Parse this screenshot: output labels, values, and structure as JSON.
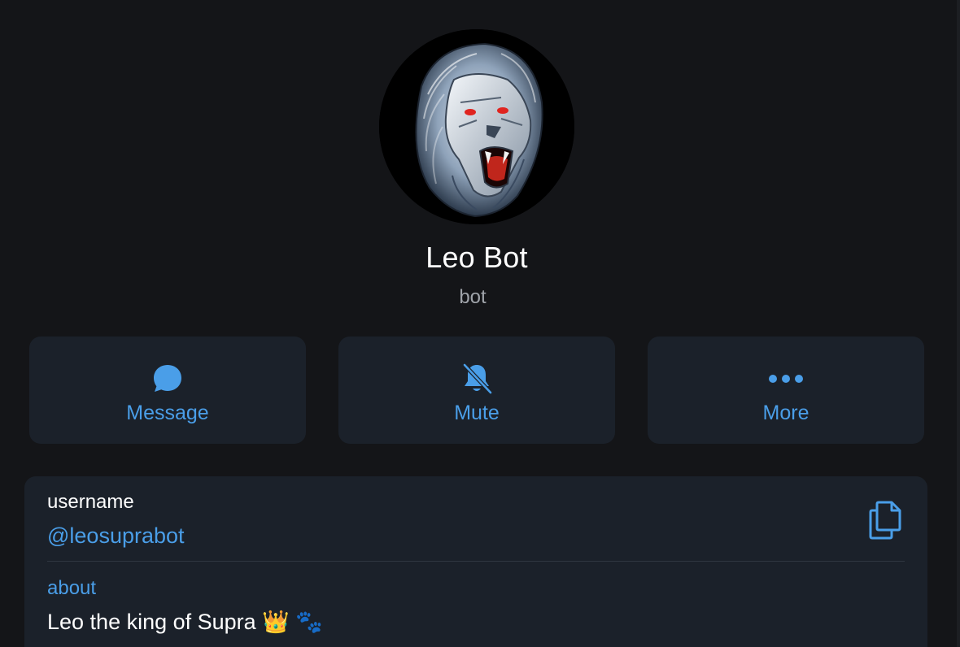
{
  "profile": {
    "name": "Leo Bot",
    "subtitle": "bot",
    "avatar_icon": "robot-lion-avatar"
  },
  "actions": [
    {
      "label": "Message",
      "icon": "chat-bubble-icon"
    },
    {
      "label": "Mute",
      "icon": "bell-off-icon"
    },
    {
      "label": "More",
      "icon": "more-dots-icon"
    }
  ],
  "info": {
    "username_label": "username",
    "username_value": "@leosuprabot",
    "copy_icon": "copy-icon",
    "about_label": "about",
    "about_value": "Leo the king of Supra 👑 🐾"
  },
  "colors": {
    "background": "#141518",
    "card": "#1b212a",
    "accent": "#4a9ee8",
    "text": "#ffffff",
    "muted": "#a0a4aa"
  }
}
